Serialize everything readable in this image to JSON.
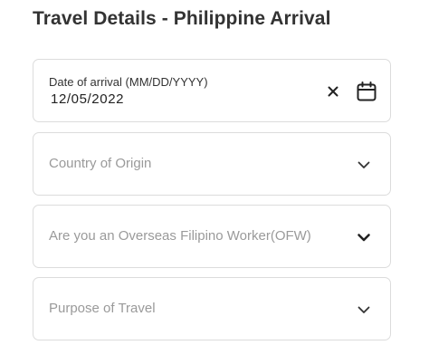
{
  "page": {
    "title": "Travel Details - Philippine Arrival"
  },
  "arrival_date": {
    "label": "Date of arrival (MM/DD/YYYY)",
    "value": "12/05/2022",
    "clear_icon": "close-icon",
    "calendar_icon": "calendar-icon"
  },
  "country_of_origin": {
    "placeholder": "Country of Origin",
    "icon": "chevron-down-icon"
  },
  "ofw": {
    "placeholder": "Are you an Overseas Filipino Worker(OFW)",
    "icon": "chevron-down-icon"
  },
  "purpose_of_travel": {
    "placeholder": "Purpose of Travel",
    "icon": "chevron-down-icon"
  }
}
